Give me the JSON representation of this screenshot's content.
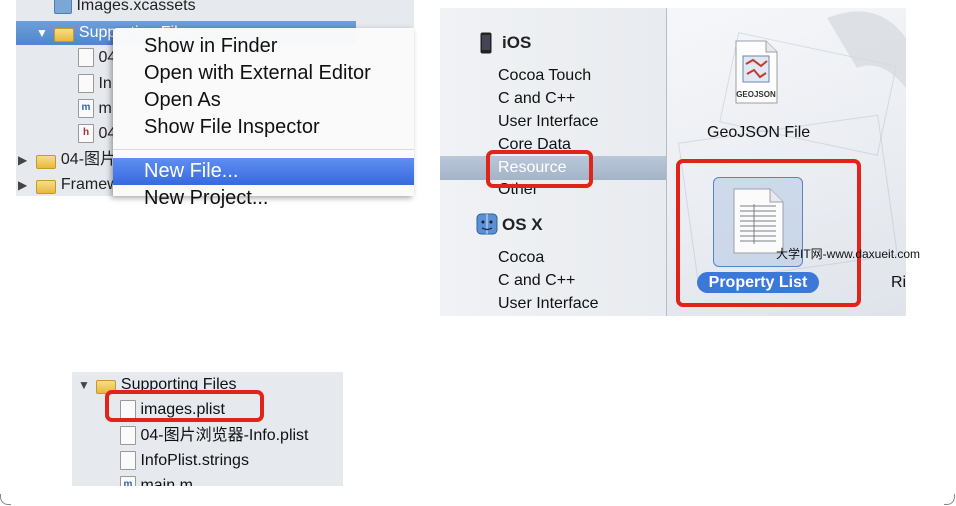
{
  "navigator": {
    "rows": [
      {
        "label": "Images.xcassets"
      },
      {
        "label": "Supporting Files"
      },
      {
        "label": "04"
      },
      {
        "label": "In"
      },
      {
        "label": "m"
      },
      {
        "label": "04"
      },
      {
        "label": "04-图片"
      },
      {
        "label": "Framew"
      }
    ]
  },
  "context_menu": {
    "items": [
      {
        "label": "Show in Finder"
      },
      {
        "label": "Open with External Editor"
      },
      {
        "label": "Open As"
      },
      {
        "label": "Show File Inspector"
      },
      {
        "label": "New File..."
      },
      {
        "label": "New Project..."
      }
    ]
  },
  "template_chooser": {
    "ios_header": "iOS",
    "ios_categories": [
      "Cocoa Touch",
      "C and C++",
      "User Interface",
      "Core Data",
      "Resource",
      "Other"
    ],
    "osx_header": "OS X",
    "osx_categories": [
      "Cocoa",
      "C and C++",
      "User Interface"
    ],
    "geojson_icon_label": "GEOJSON",
    "geojson_title": "GeoJSON File",
    "property_list_title": "Property List",
    "next_item_partial": "Ri"
  },
  "watermark": "大学IT网-www.daxueit.com",
  "supporting_files": {
    "folder": "Supporting Files",
    "items": [
      {
        "label": "images.plist"
      },
      {
        "label": "04-图片浏览器-Info.plist"
      },
      {
        "label": "InfoPlist.strings"
      },
      {
        "label": "main.m"
      }
    ]
  },
  "colors": {
    "highlight_red": "#e2231a",
    "menu_selection": "#3769e0",
    "sidebar_selection": "#a4b4c8"
  }
}
